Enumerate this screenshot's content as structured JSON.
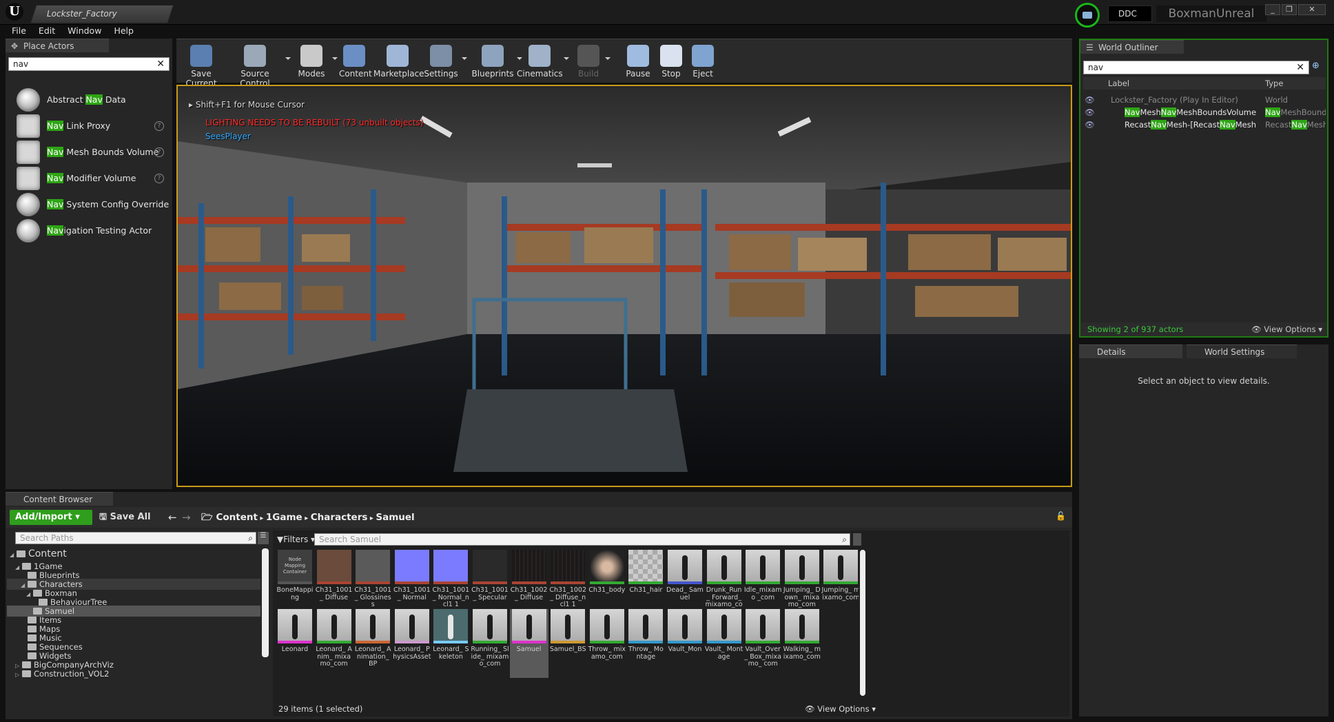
{
  "window": {
    "doc_tab": "Lockster_Factory",
    "ddc_label": "DDC",
    "project_name": "BoxmanUnreal",
    "controls": [
      "_",
      "❐",
      "✕"
    ]
  },
  "menu": [
    "File",
    "Edit",
    "Window",
    "Help"
  ],
  "place_actors": {
    "tab_label": "Place Actors",
    "search_value": "nav",
    "items": [
      {
        "pre": "Abstract ",
        "hl": "Nav",
        "post": " Data",
        "icon": "sphere-icon",
        "help": false
      },
      {
        "pre": "",
        "hl": "Nav",
        "post": " Link Proxy",
        "icon": "nav-link-proxy-icon",
        "help": true
      },
      {
        "pre": "",
        "hl": "Nav",
        "post": " Mesh Bounds Volume",
        "icon": "volume-icon",
        "help": true
      },
      {
        "pre": "",
        "hl": "Nav",
        "post": " Modifier Volume",
        "icon": "volume-icon",
        "help": true
      },
      {
        "pre": "",
        "hl": "Nav",
        "post": " System Config Override",
        "icon": "sphere-icon",
        "help": false
      },
      {
        "pre": "",
        "hl": "Nav",
        "post": "igation Testing Actor",
        "icon": "sphere-icon",
        "help": false
      }
    ]
  },
  "toolbar": [
    {
      "label": "Save Current",
      "icon": "save-icon",
      "color": "#5b7fb0",
      "dropdown": false
    },
    {
      "label": "Source Control",
      "icon": "source-control-icon",
      "color": "#9aa8b8",
      "dropdown": true
    },
    {
      "label": "Modes",
      "icon": "modes-icon",
      "color": "#c9c9c9",
      "dropdown": true
    },
    {
      "label": "Content",
      "icon": "content-icon",
      "color": "#6b8fc4",
      "dropdown": false
    },
    {
      "label": "Marketplace",
      "icon": "marketplace-icon",
      "color": "#9fb6d6",
      "dropdown": false
    },
    {
      "label": "Settings",
      "icon": "settings-icon",
      "color": "#7d8fa6",
      "dropdown": true
    },
    {
      "label": "Blueprints",
      "icon": "blueprints-icon",
      "color": "#8ea3bd",
      "dropdown": true
    },
    {
      "label": "Cinematics",
      "icon": "cinematics-icon",
      "color": "#9fb2c8",
      "dropdown": true
    },
    {
      "label": "Build",
      "icon": "build-icon",
      "color": "#555",
      "dropdown": true
    },
    {
      "label": "Pause",
      "icon": "pause-icon",
      "color": "#9fbbe0",
      "dropdown": false
    },
    {
      "label": "Stop",
      "icon": "stop-icon",
      "color": "#d9e2ee",
      "dropdown": false
    },
    {
      "label": "Eject",
      "icon": "eject-icon",
      "color": "#7fa4cf",
      "dropdown": false
    }
  ],
  "viewport": {
    "hint": "Shift+F1 for Mouse Cursor",
    "warning": "LIGHTING NEEDS TO BE REBUILT (73 unbuilt objects)",
    "player": "SeesPlayer"
  },
  "outliner": {
    "tab_label": "World Outliner",
    "search_value": "nav",
    "col_label": "Label",
    "col_type": "Type",
    "rows": [
      {
        "label": "Lockster_Factory (Play In Editor)",
        "type": "World",
        "segments": [
          {
            "t": "Lockster_Factory (Play In Editor)",
            "hl": false
          }
        ],
        "type_segments": [
          {
            "t": "World",
            "hl": false
          }
        ]
      },
      {
        "label": "NavMeshNavMeshBoundsVolume",
        "type": "NavMeshBoundsVolume",
        "segments": [
          {
            "t": "Nav",
            "hl": true
          },
          {
            "t": "Mesh",
            "hl": false
          },
          {
            "t": "Nav",
            "hl": true
          },
          {
            "t": "MeshBoundsVolume",
            "hl": false
          }
        ],
        "type_segments": [
          {
            "t": "Nav",
            "hl": true
          },
          {
            "t": "MeshBounds\\",
            "hl": false
          }
        ]
      },
      {
        "label": "RecastNavMesh-[RecastNavMesh",
        "type": "RecastNavMesh",
        "segments": [
          {
            "t": "Recast",
            "hl": false
          },
          {
            "t": "Nav",
            "hl": true
          },
          {
            "t": "Mesh-[Recast",
            "hl": false
          },
          {
            "t": "Nav",
            "hl": true
          },
          {
            "t": "Mesh",
            "hl": false
          }
        ],
        "type_segments": [
          {
            "t": "Recast",
            "hl": false
          },
          {
            "t": "Nav",
            "hl": true
          },
          {
            "t": "Mesh",
            "hl": false
          }
        ]
      }
    ],
    "status": "Showing 2 of 937 actors",
    "view_options": "View Options"
  },
  "details": {
    "tab_details": "Details",
    "tab_world_settings": "World Settings",
    "empty_message": "Select an object to view details."
  },
  "content_browser": {
    "tab_label": "Content Browser",
    "add_import": "Add/Import",
    "save_all": "Save All",
    "breadcrumb": [
      "Content",
      "1Game",
      "Characters",
      "Samuel"
    ],
    "search_paths_placeholder": "Search Paths",
    "filters_label": "Filters",
    "search_assets_placeholder": "Search Samuel",
    "tree": [
      {
        "label": "Content",
        "depth": 0,
        "arrow": "◢",
        "big": true
      },
      {
        "label": "1Game",
        "depth": 1,
        "arrow": "◢"
      },
      {
        "label": "Blueprints",
        "depth": 2,
        "arrow": ""
      },
      {
        "label": "Characters",
        "depth": 2,
        "arrow": "◢",
        "selected_parent": true
      },
      {
        "label": "Boxman",
        "depth": 3,
        "arrow": "◢"
      },
      {
        "label": "BehaviourTree",
        "depth": 4,
        "arrow": ""
      },
      {
        "label": "Samuel",
        "depth": 3,
        "arrow": "",
        "selected": true
      },
      {
        "label": "Items",
        "depth": 2,
        "arrow": ""
      },
      {
        "label": "Maps",
        "depth": 2,
        "arrow": ""
      },
      {
        "label": "Music",
        "depth": 2,
        "arrow": ""
      },
      {
        "label": "Sequences",
        "depth": 2,
        "arrow": ""
      },
      {
        "label": "Widgets",
        "depth": 2,
        "arrow": ""
      },
      {
        "label": "BigCompanyArchViz",
        "depth": 1,
        "arrow": "▷"
      },
      {
        "label": "Construction_VOL2",
        "depth": 1,
        "arrow": "▷"
      }
    ],
    "assets": [
      {
        "label": "BoneMapping",
        "thumb": "node",
        "thumb_text": "Node Mapping Container",
        "bar": "#555"
      },
      {
        "label": "Ch31_1001_ Diffuse",
        "thumb": "character-texture",
        "bar": "#a43"
      },
      {
        "label": "Ch31_1001_ Glossiness",
        "thumb": "gray-texture",
        "bar": "#a43"
      },
      {
        "label": "Ch31_1001_ Normal",
        "thumb": "normal",
        "bar": "#a43"
      },
      {
        "label": "Ch31_1001_ Normal_ncl1 1",
        "thumb": "normal",
        "bar": "#a43"
      },
      {
        "label": "Ch31_1001_ Specular",
        "thumb": "dark",
        "bar": "#a43"
      },
      {
        "label": "Ch31_1002_ Diffuse",
        "thumb": "dark-texture",
        "bar": "#a43"
      },
      {
        "label": "Ch31_1002_ Diffuse_ncl1 1",
        "thumb": "dark-texture",
        "bar": "#a43"
      },
      {
        "label": "Ch31_body",
        "thumb": "material",
        "bar": "#3a3"
      },
      {
        "label": "Ch31_hair",
        "thumb": "checker",
        "bar": "#3a3"
      },
      {
        "label": "Dead_ Samuel",
        "thumb": "figure",
        "bar": "#45c"
      },
      {
        "label": "Drunk_Run_ Forward_ mixamo_com",
        "thumb": "figure",
        "bar": "#3a3"
      },
      {
        "label": "Idle_mixamo _com",
        "thumb": "figure",
        "bar": "#3a3"
      },
      {
        "label": "Jumping_ Down_ mixamo_com",
        "thumb": "figure",
        "bar": "#3a3"
      },
      {
        "label": "Jumping_ mixamo_com",
        "thumb": "figure",
        "bar": "#3a3"
      },
      {
        "label": "Leonard",
        "thumb": "figure",
        "bar": "#d3c"
      },
      {
        "label": "Leonard_ Anim_ mixamo_com",
        "thumb": "figure",
        "bar": "#3a3"
      },
      {
        "label": "Leonard_ Animation_ BP",
        "thumb": "figure",
        "bar": "#c63"
      },
      {
        "label": "Leonard_ PhysicsAsset",
        "thumb": "figure",
        "bar": "#c9c"
      },
      {
        "label": "Leonard_ Skeleton",
        "thumb": "skeleton",
        "bar": "#7cf"
      },
      {
        "label": "Running_ Slide_ mixamo_com",
        "thumb": "figure",
        "bar": "#3a3"
      },
      {
        "label": "Samuel",
        "thumb": "figure",
        "bar": "#d3c",
        "selected": true
      },
      {
        "label": "Samuel_BS",
        "thumb": "figure",
        "bar": "#c93"
      },
      {
        "label": "Throw_ mixamo_com",
        "thumb": "figure",
        "bar": "#3a3"
      },
      {
        "label": "Throw_ Montage",
        "thumb": "figure",
        "bar": "#39c"
      },
      {
        "label": "Vault_Mon",
        "thumb": "figure",
        "bar": "#39c"
      },
      {
        "label": "Vault_ Montage",
        "thumb": "figure",
        "bar": "#39c"
      },
      {
        "label": "Vault_Over_ Box_mixamo_ com",
        "thumb": "figure",
        "bar": "#3a3"
      },
      {
        "label": "Walking_ mixamo_com",
        "thumb": "figure",
        "bar": "#3a3"
      }
    ],
    "item_count": "29 items (1 selected)",
    "view_options": "View Options"
  },
  "colors": {
    "highlight": "#2ea515",
    "viewport_border": "#c99b18",
    "outliner_border": "#1e7a12",
    "warning": "#ff2a2a",
    "player": "#2ea8ff"
  }
}
